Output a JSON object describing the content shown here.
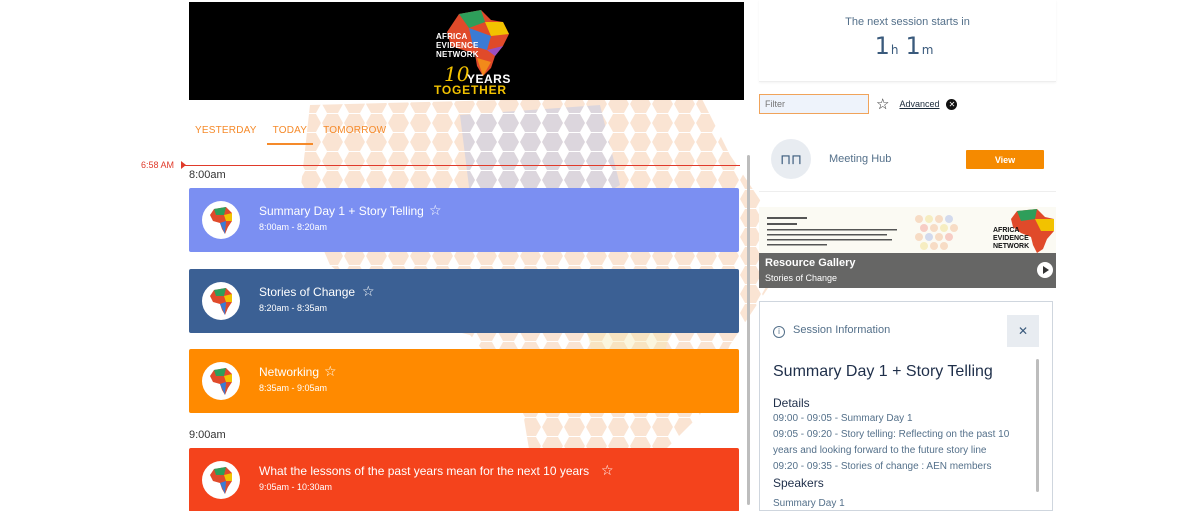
{
  "banner": {
    "logo_lines": [
      "AFRICA",
      "EVIDENCE",
      "NETWORK"
    ],
    "logo_ten": "10",
    "logo_years": "YEARS",
    "logo_together": "TOGETHER"
  },
  "tabs": [
    {
      "label": "YESTERDAY",
      "active": false
    },
    {
      "label": "TODAY",
      "active": true
    },
    {
      "label": "TOMORROW",
      "active": false
    }
  ],
  "now_indicator": "6:58 AM",
  "time_labels": [
    "8:00am",
    "9:00am"
  ],
  "sessions": [
    {
      "title": "Summary Day 1 + Story Telling",
      "time": "8:00am - 8:20am",
      "color": "#7b8ff2"
    },
    {
      "title": "Stories of Change",
      "time": "8:20am - 8:35am",
      "color": "#3b6094"
    },
    {
      "title": "Networking",
      "time": "8:35am - 9:05am",
      "color": "#ff8a00"
    },
    {
      "title": "What the lessons of the past years mean for the next 10 years",
      "time": "9:05am - 10:30am",
      "color": "#f4431c"
    }
  ],
  "countdown": {
    "label": "The next session starts in",
    "hours": "1",
    "hours_unit": "h",
    "minutes": "1",
    "minutes_unit": "m"
  },
  "filter": {
    "placeholder": "Filter",
    "advanced_label": "Advanced"
  },
  "hub": {
    "label": "Meeting Hub",
    "button_label": "View"
  },
  "gallery": {
    "title": "Resource Gallery",
    "subtitle": "Stories of Change",
    "logo_lines": [
      "AFRICA",
      "EVIDENCE",
      "NETWORK"
    ]
  },
  "session_info": {
    "header": "Session Information",
    "title": "Summary Day 1 + Story Telling",
    "details_heading": "Details",
    "details": [
      "09:00 - 09:05 - Summary Day 1",
      "09:05 - 09:20 - Story telling: Reflecting on the past 10",
      "years and looking forward to the future story line",
      "09:20 - 09:35 - Stories of change : AEN members"
    ],
    "speakers_heading": "Speakers",
    "speakers": [
      "Summary Day 1"
    ]
  },
  "colors": {
    "accent": "#f58a2a",
    "now_line": "#e03a2a"
  }
}
